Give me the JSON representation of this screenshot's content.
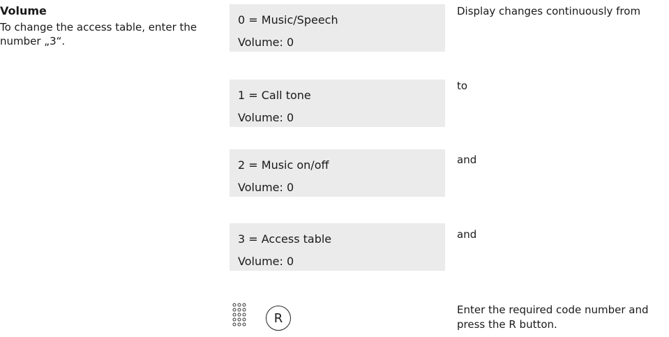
{
  "left": {
    "heading": "Volume",
    "text": "To change the access table, enter the number „3“."
  },
  "displays": [
    {
      "line1": "0 = Music/Speech",
      "line2": "Volume: 0"
    },
    {
      "line1": "1 = Call tone",
      "line2": "Volume: 0"
    },
    {
      "line1": "2 = Music on/off",
      "line2": "Volume: 0"
    },
    {
      "line1": "3 = Access table",
      "line2": "Volume: 0"
    }
  ],
  "notes": [
    "Display changes continuously from",
    "to",
    "and",
    "and",
    "Enter the required code number and press the R button."
  ],
  "keys": {
    "keypad_icon": "keypad-icon",
    "r_button_label": "R"
  }
}
